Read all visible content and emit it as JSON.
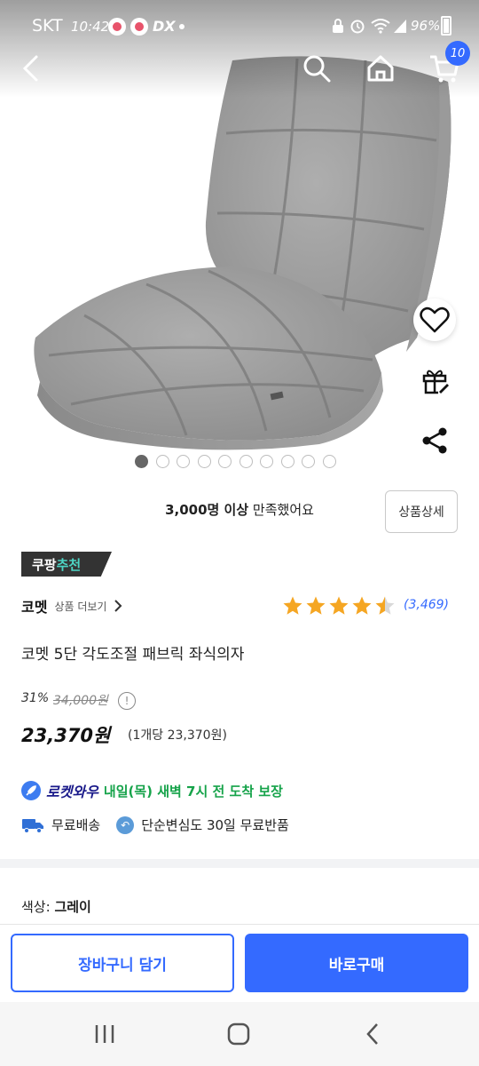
{
  "status_bar": {
    "carrier": "SKT",
    "time": "10:42",
    "extra_badge": "DX",
    "battery": "96%"
  },
  "nav": {
    "back_icon": "chevron-left-icon",
    "search_icon": "search-icon",
    "home_icon": "home-icon",
    "cart_icon": "cart-icon",
    "cart_count": "10"
  },
  "gallery": {
    "page_count": 10,
    "active_index": 0
  },
  "summary": {
    "satisfied_count": "3,000명 이상",
    "satisfied_suffix": "만족했어요",
    "detail_button": "상품상세"
  },
  "recommend_badge": {
    "prefix": "쿠팡",
    "highlight": "추천"
  },
  "product": {
    "brand": "코멧",
    "brand_more": "상품 더보기",
    "rating": 4.5,
    "review_count": "(3,469)",
    "title": "코멧 5단 각도조절 패브릭 좌식의자",
    "discount": "31%",
    "original_price": "34,000원",
    "price": "23,370원",
    "unit_price": "(1개당 23,370원)"
  },
  "delivery": {
    "rocket_label": "로켓와우",
    "arrival": "내일(목) 새벽 7시 전 도착 보장",
    "free_shipping": "무료배송",
    "free_return": "단순변심도 30일 무료반품"
  },
  "option": {
    "label": "색상:",
    "value": "그레이"
  },
  "actions": {
    "add_to_cart": "장바구니 담기",
    "buy_now": "바로구매"
  },
  "colors": {
    "accent": "#346aff",
    "arrival_green": "#16a34a",
    "badge_bg": "#333333",
    "star": "#f5a623"
  }
}
